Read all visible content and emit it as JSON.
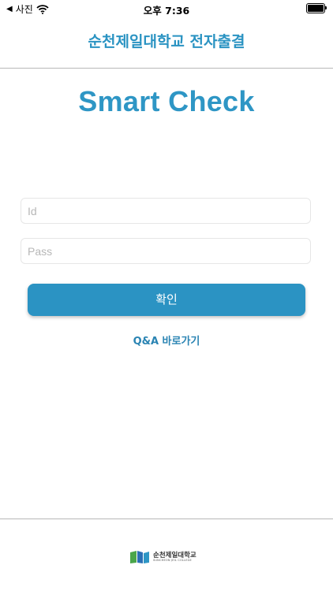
{
  "status_bar": {
    "back_app": "사진",
    "time": "오후 7:36"
  },
  "header": {
    "title": "순천제일대학교 전자출결"
  },
  "brand": {
    "name": "Smart Check"
  },
  "login": {
    "id_placeholder": "Id",
    "pass_placeholder": "Pass",
    "confirm_label": "확인"
  },
  "qa_link": {
    "label": "Q&A 바로가기"
  },
  "footer": {
    "logo_name": "순천제일대학교",
    "logo_sub": "SUNCHEON JEIL COLLEGE"
  },
  "colors": {
    "accent": "#2b93c3",
    "divider": "#b8b8b8"
  }
}
